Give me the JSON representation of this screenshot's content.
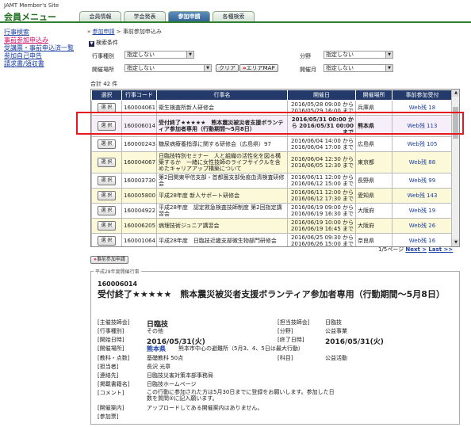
{
  "header": {
    "site_title": "JAMT Member's Site",
    "menu_title": "会員メニュー",
    "tabs": [
      "会員情報",
      "学会発表",
      "参加申請",
      "各種検索"
    ]
  },
  "sidebar": {
    "items": [
      "行事検索",
      "事前参加申込み",
      "受講票・事前申込済一覧",
      "参加自己申告",
      "請求書/領収書"
    ]
  },
  "breadcrumb": {
    "link": "参加申請",
    "separator": ">",
    "current": "事前参加申込み",
    "prefix": "»"
  },
  "search": {
    "header": "検索条件",
    "event_type_label": "行事種別",
    "event_type_value": "指定しない",
    "field_label": "分野",
    "field_value": "指定しない",
    "venue_label": "開催場所",
    "venue_value": "指定しない",
    "month_label": "開催月",
    "month_value": "指定しない",
    "clear_button": "クリア",
    "area_map_button": "エリアMAP",
    "dropdown_arrow": "▼"
  },
  "total": "合計 42 件",
  "table": {
    "headers": [
      "選択",
      "行事コード",
      "行事名",
      "開催日",
      "開催場所",
      "事前参加受付"
    ],
    "select_label": "選 択",
    "rows": [
      {
        "code": "160004061",
        "name": "衛生検査所新人研修会",
        "date": "2016/05/28 09:00 から 2016/05/29 16:00 まで",
        "place": "兵庫県",
        "web": "Web残 18"
      },
      {
        "code": "160006014",
        "name": "受付終了★★★★★　熊本震災被災者支援ボランティア参加者専用（行動期間〜5月8日）",
        "date": "2016/05/31 00:00 から 2016/05/31 00:00 まで",
        "place": "熊本県",
        "web": "Web残 113"
      },
      {
        "code": "160000243",
        "name": "糖尿病療養指導に関する研修会（広島県）97",
        "date": "2016/06/04 14:00 から 2016/06/04 17:00 まで",
        "place": "広島県",
        "web": "Web残 105"
      },
      {
        "code": "160004067",
        "name": "日臨技特別セミナー　人と組織の活性化を図る構築するか　一緒に女性技師のライフサイクルを含めたキャリアアップ構築について",
        "date": "2016/06/04 12:30 から 2016/06/05 12:30 まで",
        "place": "東京都",
        "web": "Web残 88"
      },
      {
        "code": "160003730",
        "name": "第2回関東甲信支部・首都圏支部免疫血清検査研修会",
        "date": "2016/06/11 12:00 から 2016/06/12 15:00 まで",
        "place": "長野県",
        "web": "Web残 99"
      },
      {
        "code": "160005800",
        "name": "平成28年度 新人サポート研修会",
        "date": "2016/06/11 12:00 から 2016/06/12 17:30 まで",
        "place": "愛知県",
        "web": "Web残 143"
      },
      {
        "code": "160004922",
        "name": "平成28年度　認定救急検査技師制度 第2回指定講習会",
        "date": "2016/06/19 09:00 から 2016/06/19 16:30 まで",
        "place": "大阪府",
        "web": "Web残 19"
      },
      {
        "code": "160006205",
        "name": "病理技術ジュニア講習会",
        "date": "2016/06/19 10:00 から 2016/06/19 16:45 まで",
        "place": "大阪府",
        "web": "Web残 26"
      },
      {
        "code": "160001064",
        "name": "平成28年度　日臨技近畿支部微生物部門研修会",
        "date": "2016/06/25 09:30 から 2016/06/26 15:00 まで",
        "place": "奈良県",
        "web": "Web残 16"
      },
      {
        "code": "",
        "name": "",
        "date": "",
        "place": "",
        "web": ""
      }
    ]
  },
  "pager": {
    "text": "1/5ページ",
    "next": "Next >",
    "last": "Last >>"
  },
  "pre_register_button": "事前参加申請",
  "detail": {
    "legend": "平成28年度開催行事",
    "code": "160006014",
    "title": "受付終了★★★★★　熊本震災被災者支援ボランティア参加者専用（行動期間〜5月8日）",
    "rows": [
      {
        "k": "[主催技師会]",
        "v": "日臨技",
        "k2": "[担当技師会]",
        "v2": "日臨技"
      },
      {
        "k": "[行事種別]",
        "v": "その他",
        "k2": "[分野]",
        "v2": "公益事業"
      },
      {
        "k": "[開始日時]",
        "v": "2016/05/31(火)",
        "k2": "[終了日時]",
        "v2": "2016/05/31(火)"
      },
      {
        "k": "[開催場所]",
        "v": "熊本県",
        "v_sub": "熊本市中心の避難所（5月3、4、5日は最大行動）"
      },
      {
        "k": "[教科・点数]",
        "v": "基礎教科 50点",
        "k2": "[科目]",
        "v2": "公益活動"
      },
      {
        "k": "[担当者]",
        "v": "長沢 光章"
      },
      {
        "k": "[連絡先]",
        "v": "日臨技災害対策本部事務局"
      },
      {
        "k": "[掲載書籍名]",
        "v": "日臨技ホームページ"
      },
      {
        "k": "[コメント]",
        "v": "この行動に参加された方は5月30日までに登録をお願いします。参加した日数を質問②に記入願います。"
      },
      {
        "k": "[開催案内]",
        "v": "アップロードしてある開催案内はありません。"
      },
      {
        "k": "[参加票]",
        "v": ""
      }
    ]
  },
  "colors": {
    "accent_green": "#1b6e1b",
    "header_blue": "#233a6a",
    "highlight_red": "#e5191f",
    "link_blue": "#1a3fa0"
  }
}
